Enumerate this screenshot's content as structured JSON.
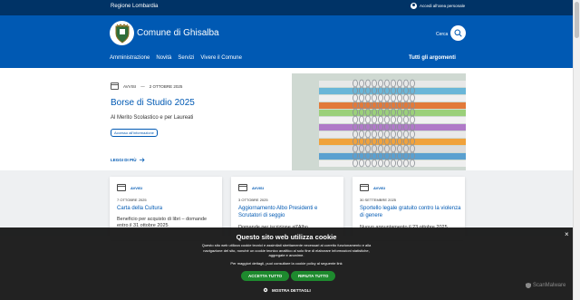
{
  "topbar": {
    "region": "Regione Lombardia",
    "login": "Accedi all'area personale"
  },
  "header": {
    "title": "Comune di Ghisalba",
    "search_label": "Cerca"
  },
  "nav": {
    "items": [
      {
        "label": "Amministrazione"
      },
      {
        "label": "Novità"
      },
      {
        "label": "Servizi"
      },
      {
        "label": "Vivere il Comune"
      }
    ],
    "all_topics": "Tutti gli argomenti"
  },
  "hero": {
    "category": "AVVISI",
    "separator": "—",
    "date": "2 OTTOBRE 2025",
    "title": "Borse di Studio 2025",
    "subtitle": "Al Merito Scolastico e per Laureati",
    "tag": "Accesso all'informazione",
    "read_more": "LEGGI DI PIÙ"
  },
  "cards": [
    {
      "category": "AVVISI",
      "date": "7 OTTOBRE 2025",
      "title": "Carta della Cultura",
      "description": "Beneficio per acquisto di libri – domande entro il 31 ottobre 2025"
    },
    {
      "category": "AVVISI",
      "date": "3 OTTOBRE 2025",
      "title": "Aggiornamento Albo Presidenti e Scrutatori di seggio",
      "description": "Domande per iscrizione all'Albo"
    },
    {
      "category": "AVVISI",
      "date": "30 SETTEMBRE 2025",
      "title": "Sportello legale gratuito contro la violenza di genere",
      "description": "Nuovo appuntamento il 23 ottobre 2025"
    }
  ],
  "cookie": {
    "title": "Questo sito web utilizza cookie",
    "body": "Questo sito web utilizza cookie tecnici e assimilati strettamente necessari al corretto funzionamento e alla navigazione del sito, nonché un cookie tecnico analitico al solo fine di elaborare informazioni statistiche, aggregate e anonime.",
    "more": "Per maggiori dettagli, puoi consultare la cookie policy al seguente link",
    "accept": "ACCETTA TUTTO",
    "reject": "RIFIUTA TUTTO",
    "details": "MOSTRA DETTAGLI",
    "close": "×"
  },
  "watermark": "ScanMalware",
  "colors": {
    "primary": "#0059b3",
    "topbar": "#003366",
    "button_green": "#1e8a2e"
  }
}
